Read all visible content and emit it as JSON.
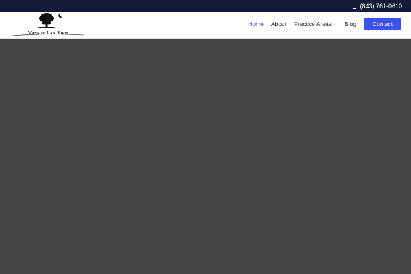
{
  "topbar": {
    "phone": "(843) 761-0610",
    "phone_icon": "mobile-phone-icon"
  },
  "header": {
    "logo_text": "Vannoy Law Firm",
    "logo_icon": "tree-and-moon-logo"
  },
  "nav": {
    "items": [
      {
        "label": "Home",
        "active": true
      },
      {
        "label": "About",
        "active": false
      },
      {
        "label": "Practice Areas",
        "active": false,
        "has_dropdown": true
      },
      {
        "label": "Blog",
        "active": false
      }
    ],
    "contact_label": "Contact"
  },
  "colors": {
    "topbar_bg": "#141a38",
    "accent": "#3b50f0",
    "active_link": "#3a4bd1",
    "hero_bg": "#444444"
  }
}
